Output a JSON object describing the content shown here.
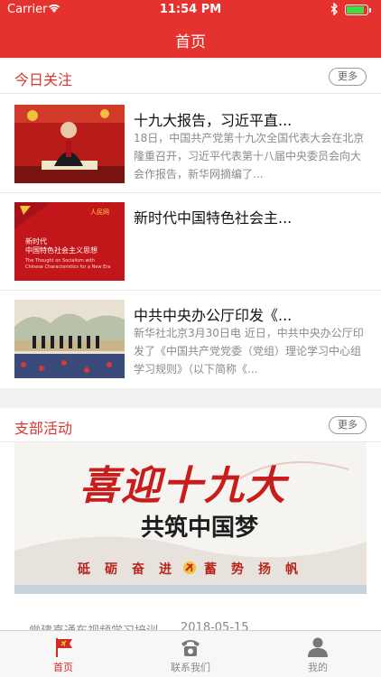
{
  "status_bar": {
    "carrier": "Carrier",
    "time": "11:54 PM",
    "battery_level": 0.85
  },
  "header": {
    "title": "首页"
  },
  "today_focus": {
    "title": "今日关注",
    "more_label": "更多",
    "items": [
      {
        "title": "十九大报告，习近平直...",
        "summary": "18日，中国共产党第十九次全国代表大会在北京隆重召开，习近平代表第十八届中央委员会向大会作报告，新华网摘编了..."
      },
      {
        "title": "新时代中国特色社会主...",
        "summary": "",
        "thumb_brand": "人民网",
        "thumb_heading1": "新时代",
        "thumb_heading2": "中国特色社会主义思想",
        "thumb_en1": "The Thought on Socialism with",
        "thumb_en2": "Chinese Characteristics for a New Era"
      },
      {
        "title": "中共中央办公厅印发《...",
        "summary": "新华社北京3月30日电 近日，中共中央办公厅印发了《中国共产党党委（党组）理论学习中心组学习规则》（以下简称《..."
      }
    ]
  },
  "branch_activity": {
    "title": "支部活动",
    "more_label": "更多",
    "banner": {
      "headline": "喜迎十九大",
      "subline": "共筑中国梦",
      "slogan": [
        "砥",
        "砺",
        "奋",
        "进",
        "蓄",
        "势",
        "扬",
        "帆"
      ]
    },
    "caption": {
      "title": "党建直通车视频学习培训",
      "date": "2018-05-15"
    }
  },
  "tabbar": {
    "items": [
      {
        "label": "首页",
        "icon": "party-flag-icon",
        "active": true
      },
      {
        "label": "联系我们",
        "icon": "phone-icon",
        "active": false
      },
      {
        "label": "我的",
        "icon": "user-icon",
        "active": false
      }
    ]
  },
  "colors": {
    "brand_red": "#e5322f",
    "section_title": "#d43a33",
    "battery_green": "#3adf4a"
  }
}
